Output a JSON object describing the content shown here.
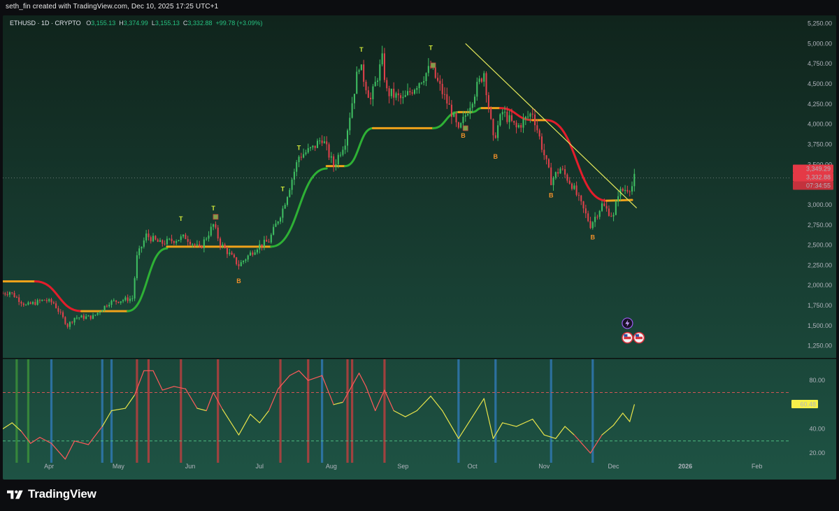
{
  "header": {
    "credit": "seth_fin created with TradingView.com, Dec 10, 2025 17:25 UTC+1",
    "symbol": "ETHUSD · 1D · CRYPTO",
    "open_key": "O",
    "open": "3,155.13",
    "high_key": "H",
    "high": "3,374.99",
    "low_key": "L",
    "low": "3,155.13",
    "close_key": "C",
    "close": "3,332.88",
    "change": "+99.78 (+3.09%)"
  },
  "brand": {
    "name": "TradingView"
  },
  "colors": {
    "bg_top": "#10241c",
    "bg_bottom": "#1e5344",
    "up": "#3fbf62",
    "down": "#e0414b",
    "trend_up": "#2eb135",
    "trend_down": "#e41d2b",
    "trend_flat": "#f0a21a",
    "trendline": "#e4e85a",
    "rsi": "#e8e44a",
    "rsi_hot": "#ff5a5a",
    "price_tag": "#e53946",
    "band_red": "#b74040",
    "band_blue": "#2f78b0",
    "band_green": "#3b8f3b"
  },
  "chart_data": [
    {
      "type": "candlestick",
      "title": "",
      "ylim": [
        1100,
        5350
      ],
      "y_ticks": [
        "5,250.00",
        "5,000.00",
        "4,750.00",
        "4,500.00",
        "4,250.00",
        "4,000.00",
        "3,750.00",
        "3,500.00",
        "3,250.00",
        "3,000.00",
        "2,750.00",
        "2,500.00",
        "2,250.00",
        "2,000.00",
        "1,750.00",
        "1,500.00",
        "1,250.00"
      ],
      "y_tick_values": [
        5250,
        5000,
        4750,
        4500,
        4250,
        4000,
        3750,
        3500,
        3250,
        3000,
        2750,
        2500,
        2250,
        2000,
        1750,
        1500,
        1250
      ],
      "x_ticks": [
        "Apr",
        "May",
        "Jun",
        "Jul",
        "Aug",
        "Sep",
        "Oct",
        "Nov",
        "Dec",
        "2026",
        "Feb"
      ],
      "x_tick_dates": [
        "2025-04-01",
        "2025-05-01",
        "2025-06-01",
        "2025-07-01",
        "2025-08-01",
        "2025-09-01",
        "2025-10-01",
        "2025-11-01",
        "2025-12-01",
        "2026-01-01",
        "2026-02-01"
      ],
      "x_range": [
        "2025-03-12",
        "2026-02-15"
      ],
      "close_anchors": [
        {
          "date": "2025-03-12",
          "close": 1900
        },
        {
          "date": "2025-03-15",
          "close": 1920
        },
        {
          "date": "2025-03-22",
          "close": 1750
        },
        {
          "date": "2025-03-30",
          "close": 1820
        },
        {
          "date": "2025-04-03",
          "close": 1780
        },
        {
          "date": "2025-04-09",
          "close": 1500
        },
        {
          "date": "2025-04-12",
          "close": 1600
        },
        {
          "date": "2025-04-20",
          "close": 1610
        },
        {
          "date": "2025-04-27",
          "close": 1790
        },
        {
          "date": "2025-05-07",
          "close": 1840
        },
        {
          "date": "2025-05-09",
          "close": 2350
        },
        {
          "date": "2025-05-13",
          "close": 2620
        },
        {
          "date": "2025-05-19",
          "close": 2520
        },
        {
          "date": "2025-05-30",
          "close": 2600
        },
        {
          "date": "2025-06-05",
          "close": 2450
        },
        {
          "date": "2025-06-11",
          "close": 2750
        },
        {
          "date": "2025-06-14",
          "close": 2520
        },
        {
          "date": "2025-06-22",
          "close": 2250
        },
        {
          "date": "2025-06-30",
          "close": 2480
        },
        {
          "date": "2025-07-05",
          "close": 2550
        },
        {
          "date": "2025-07-11",
          "close": 2950
        },
        {
          "date": "2025-07-18",
          "close": 3600
        },
        {
          "date": "2025-07-24",
          "close": 3700
        },
        {
          "date": "2025-07-28",
          "close": 3830
        },
        {
          "date": "2025-08-02",
          "close": 3480
        },
        {
          "date": "2025-08-07",
          "close": 3800
        },
        {
          "date": "2025-08-13",
          "close": 4750
        },
        {
          "date": "2025-08-18",
          "close": 4300
        },
        {
          "date": "2025-08-23",
          "close": 4800
        },
        {
          "date": "2025-08-25",
          "close": 4400
        },
        {
          "date": "2025-09-01",
          "close": 4300
        },
        {
          "date": "2025-09-13",
          "close": 4700
        },
        {
          "date": "2025-09-22",
          "close": 4150
        },
        {
          "date": "2025-09-25",
          "close": 3900
        },
        {
          "date": "2025-10-02",
          "close": 4400
        },
        {
          "date": "2025-10-06",
          "close": 4650
        },
        {
          "date": "2025-10-10",
          "close": 3800
        },
        {
          "date": "2025-10-14",
          "close": 4150
        },
        {
          "date": "2025-10-20",
          "close": 3950
        },
        {
          "date": "2025-10-27",
          "close": 4150
        },
        {
          "date": "2025-11-04",
          "close": 3300
        },
        {
          "date": "2025-11-08",
          "close": 3450
        },
        {
          "date": "2025-11-13",
          "close": 3250
        },
        {
          "date": "2025-11-21",
          "close": 2750
        },
        {
          "date": "2025-11-26",
          "close": 3000
        },
        {
          "date": "2025-12-01",
          "close": 2850
        },
        {
          "date": "2025-12-03",
          "close": 3150
        },
        {
          "date": "2025-12-09",
          "close": 3233
        },
        {
          "date": "2025-12-10",
          "close": 3333
        }
      ],
      "trend_line_segments": [
        {
          "from": "2025-03-12",
          "to": "2025-03-26",
          "value_from": 2050,
          "value_to": 2050,
          "state": "flat"
        },
        {
          "from": "2025-03-26",
          "to": "2025-04-15",
          "value_from": 2050,
          "value_to": 1680,
          "state": "down"
        },
        {
          "from": "2025-04-15",
          "to": "2025-05-05",
          "value_from": 1680,
          "value_to": 1680,
          "state": "flat"
        },
        {
          "from": "2025-05-05",
          "to": "2025-05-22",
          "value_from": 1680,
          "value_to": 2460,
          "state": "up"
        },
        {
          "from": "2025-05-22",
          "to": "2025-07-06",
          "value_from": 2480,
          "value_to": 2480,
          "state": "flat"
        },
        {
          "from": "2025-07-06",
          "to": "2025-07-30",
          "value_from": 2480,
          "value_to": 3450,
          "state": "up"
        },
        {
          "from": "2025-07-30",
          "to": "2025-08-07",
          "value_from": 3480,
          "value_to": 3480,
          "state": "flat"
        },
        {
          "from": "2025-08-07",
          "to": "2025-08-19",
          "value_from": 3480,
          "value_to": 3950,
          "state": "up"
        },
        {
          "from": "2025-08-19",
          "to": "2025-09-14",
          "value_from": 3950,
          "value_to": 3950,
          "state": "flat"
        },
        {
          "from": "2025-09-14",
          "to": "2025-09-25",
          "value_from": 3950,
          "value_to": 4150,
          "state": "up"
        },
        {
          "from": "2025-09-25",
          "to": "2025-10-01",
          "value_from": 4150,
          "value_to": 4150,
          "state": "flat"
        },
        {
          "from": "2025-10-01",
          "to": "2025-10-05",
          "value_from": 4150,
          "value_to": 4200,
          "state": "up"
        },
        {
          "from": "2025-10-05",
          "to": "2025-10-13",
          "value_from": 4200,
          "value_to": 4200,
          "state": "flat"
        },
        {
          "from": "2025-10-13",
          "to": "2025-10-27",
          "value_from": 4200,
          "value_to": 4050,
          "state": "down"
        },
        {
          "from": "2025-10-27",
          "to": "2025-11-02",
          "value_from": 4050,
          "value_to": 4050,
          "state": "flat"
        },
        {
          "from": "2025-11-02",
          "to": "2025-11-28",
          "value_from": 4050,
          "value_to": 3050,
          "state": "down"
        },
        {
          "from": "2025-11-28",
          "to": "2025-12-09",
          "value_from": 3050,
          "value_to": 3060,
          "state": "flat"
        }
      ],
      "trendline": {
        "from": "2025-09-28",
        "value_from": 5000,
        "to": "2025-12-11",
        "value_to": 2960
      },
      "last_price_line": 3332.88,
      "price_labels": [
        "3,349.29",
        "3,332.88",
        "07:34:55"
      ],
      "signals": [
        {
          "label": "T",
          "date": "2025-05-28",
          "price": 2800
        },
        {
          "label": "T",
          "date": "2025-06-11",
          "price": 2930
        },
        {
          "label": "B",
          "date": "2025-06-22",
          "price": 2030
        },
        {
          "label": "T",
          "date": "2025-07-11",
          "price": 3170
        },
        {
          "label": "T",
          "date": "2025-07-18",
          "price": 3680
        },
        {
          "label": "T",
          "date": "2025-08-14",
          "price": 4900
        },
        {
          "label": "T",
          "date": "2025-09-13",
          "price": 4920
        },
        {
          "label": "B",
          "date": "2025-09-27",
          "price": 3830
        },
        {
          "label": "B",
          "date": "2025-10-11",
          "price": 3570
        },
        {
          "label": "B",
          "date": "2025-11-04",
          "price": 3090
        },
        {
          "label": "B",
          "date": "2025-11-22",
          "price": 2570
        }
      ],
      "markers": [
        {
          "date": "2025-06-12",
          "price": 2850,
          "kind": "square"
        },
        {
          "date": "2025-09-14",
          "price": 4730,
          "kind": "square"
        },
        {
          "date": "2025-09-28",
          "price": 3950,
          "kind": "square"
        },
        {
          "date": "2025-12-07",
          "price": 1530,
          "kind": "event-icon"
        },
        {
          "date": "2025-12-07",
          "price": 1350,
          "kind": "flag-icon"
        },
        {
          "date": "2025-12-12",
          "price": 1350,
          "kind": "flag-icon"
        }
      ]
    },
    {
      "type": "line",
      "title": "",
      "ylim": [
        12,
        98
      ],
      "y_ticks": [
        "80.00",
        "40.00",
        "20.00"
      ],
      "y_tick_values": [
        80,
        40,
        20
      ],
      "upper_level": 70,
      "lower_level": 30,
      "last_value_label": "60.48",
      "last_value": 60.48,
      "series": [
        {
          "points": [
            {
              "date": "2025-03-12",
              "value": 40
            },
            {
              "date": "2025-03-16",
              "value": 45
            },
            {
              "date": "2025-03-20",
              "value": 38
            },
            {
              "date": "2025-03-24",
              "value": 28
            },
            {
              "date": "2025-03-28",
              "value": 33
            },
            {
              "date": "2025-04-02",
              "value": 28
            },
            {
              "date": "2025-04-08",
              "value": 15
            },
            {
              "date": "2025-04-12",
              "value": 30
            },
            {
              "date": "2025-04-18",
              "value": 27
            },
            {
              "date": "2025-04-24",
              "value": 42
            },
            {
              "date": "2025-04-28",
              "value": 55
            },
            {
              "date": "2025-05-04",
              "value": 57
            },
            {
              "date": "2025-05-08",
              "value": 68
            },
            {
              "date": "2025-05-12",
              "value": 88
            },
            {
              "date": "2025-05-16",
              "value": 88
            },
            {
              "date": "2025-05-20",
              "value": 72
            },
            {
              "date": "2025-05-25",
              "value": 75
            },
            {
              "date": "2025-05-30",
              "value": 73
            },
            {
              "date": "2025-06-04",
              "value": 57
            },
            {
              "date": "2025-06-08",
              "value": 55
            },
            {
              "date": "2025-06-11",
              "value": 70
            },
            {
              "date": "2025-06-15",
              "value": 56
            },
            {
              "date": "2025-06-22",
              "value": 35
            },
            {
              "date": "2025-06-27",
              "value": 52
            },
            {
              "date": "2025-07-01",
              "value": 45
            },
            {
              "date": "2025-07-05",
              "value": 55
            },
            {
              "date": "2025-07-09",
              "value": 73
            },
            {
              "date": "2025-07-14",
              "value": 84
            },
            {
              "date": "2025-07-18",
              "value": 88
            },
            {
              "date": "2025-07-22",
              "value": 80
            },
            {
              "date": "2025-07-28",
              "value": 84
            },
            {
              "date": "2025-08-02",
              "value": 60
            },
            {
              "date": "2025-08-06",
              "value": 62
            },
            {
              "date": "2025-08-13",
              "value": 86
            },
            {
              "date": "2025-08-16",
              "value": 75
            },
            {
              "date": "2025-08-20",
              "value": 55
            },
            {
              "date": "2025-08-24",
              "value": 72
            },
            {
              "date": "2025-08-28",
              "value": 55
            },
            {
              "date": "2025-09-02",
              "value": 50
            },
            {
              "date": "2025-09-07",
              "value": 55
            },
            {
              "date": "2025-09-13",
              "value": 67
            },
            {
              "date": "2025-09-18",
              "value": 55
            },
            {
              "date": "2025-09-25",
              "value": 32
            },
            {
              "date": "2025-10-01",
              "value": 50
            },
            {
              "date": "2025-10-06",
              "value": 65
            },
            {
              "date": "2025-10-10",
              "value": 32
            },
            {
              "date": "2025-10-14",
              "value": 45
            },
            {
              "date": "2025-10-20",
              "value": 42
            },
            {
              "date": "2025-10-27",
              "value": 48
            },
            {
              "date": "2025-11-01",
              "value": 35
            },
            {
              "date": "2025-11-06",
              "value": 32
            },
            {
              "date": "2025-11-10",
              "value": 42
            },
            {
              "date": "2025-11-14",
              "value": 35
            },
            {
              "date": "2025-11-21",
              "value": 20
            },
            {
              "date": "2025-11-26",
              "value": 35
            },
            {
              "date": "2025-12-01",
              "value": 43
            },
            {
              "date": "2025-12-05",
              "value": 53
            },
            {
              "date": "2025-12-08",
              "value": 46
            },
            {
              "date": "2025-12-10",
              "value": 60
            }
          ]
        }
      ],
      "vertical_bands": [
        {
          "date": "2025-03-18",
          "color": "green"
        },
        {
          "date": "2025-03-23",
          "color": "green"
        },
        {
          "date": "2025-04-02",
          "color": "blue"
        },
        {
          "date": "2025-04-24",
          "color": "blue"
        },
        {
          "date": "2025-04-28",
          "color": "blue"
        },
        {
          "date": "2025-05-09",
          "color": "red"
        },
        {
          "date": "2025-05-14",
          "color": "red"
        },
        {
          "date": "2025-05-28",
          "color": "red"
        },
        {
          "date": "2025-06-13",
          "color": "red"
        },
        {
          "date": "2025-07-10",
          "color": "red"
        },
        {
          "date": "2025-07-22",
          "color": "red"
        },
        {
          "date": "2025-07-28",
          "color": "blue"
        },
        {
          "date": "2025-08-08",
          "color": "red"
        },
        {
          "date": "2025-08-10",
          "color": "red"
        },
        {
          "date": "2025-08-24",
          "color": "red"
        },
        {
          "date": "2025-09-25",
          "color": "blue"
        },
        {
          "date": "2025-10-11",
          "color": "blue"
        },
        {
          "date": "2025-11-04",
          "color": "blue"
        },
        {
          "date": "2025-11-22",
          "color": "blue"
        }
      ]
    }
  ]
}
